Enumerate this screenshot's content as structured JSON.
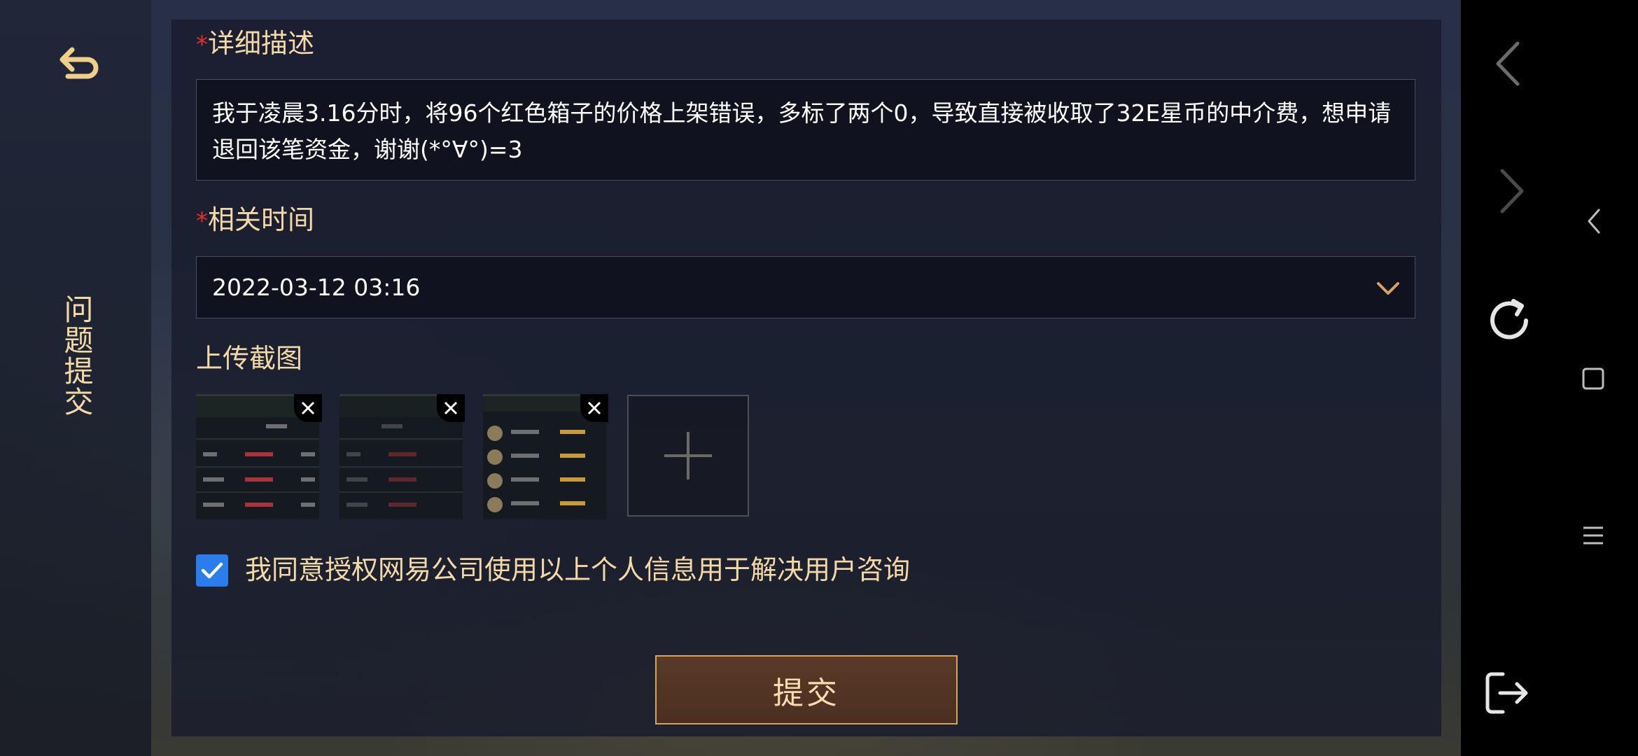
{
  "sidebar": {
    "title": "问题提交",
    "back_icon": "return-arrow-icon"
  },
  "form": {
    "description": {
      "required_mark": "*",
      "label": "详细描述",
      "value": "我于凌晨3.16分时，将96个红色箱子的价格上架错误，多标了两个0，导致直接被收取了32E星币的中介费，想申请退回该笔资金，谢谢(*°∀°)=3"
    },
    "time": {
      "required_mark": "*",
      "label": "相关时间",
      "value": "2022-03-12 03:16"
    },
    "upload": {
      "label": "上传截图",
      "screenshots": [
        "screenshot-1",
        "screenshot-2",
        "screenshot-3"
      ],
      "add_icon": "plus-icon"
    },
    "consent": {
      "checked": true,
      "text": "我同意授权网易公司使用以上个人信息用于解决用户咨询"
    },
    "submit_label": "提交"
  },
  "colors": {
    "label_gold": "#f2d9a6",
    "required_red": "#e0312c",
    "checkbox_blue": "#2a7dea",
    "submit_border": "#d8a263"
  },
  "system_nav": [
    "back-arrow-icon",
    "forward-arrow-icon",
    "collapse-icon",
    "refresh-icon",
    "square-icon",
    "menu-icon",
    "exit-icon"
  ]
}
